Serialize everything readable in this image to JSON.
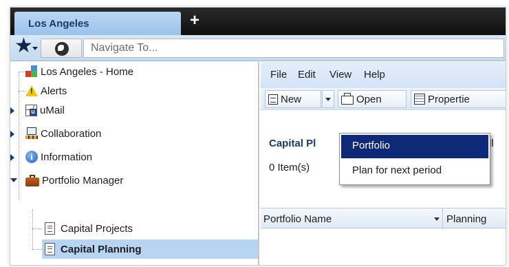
{
  "tab": {
    "title": "Los Angeles",
    "new_tab": "+"
  },
  "nav": {
    "placeholder": "Navigate To..."
  },
  "sidebar": {
    "items": [
      {
        "label": "Los Angeles - Home"
      },
      {
        "label": "Alerts"
      },
      {
        "label": "uMail"
      },
      {
        "label": "Collaboration"
      },
      {
        "label": "Information"
      },
      {
        "label": "Portfolio Manager"
      },
      {
        "label": "Capital Projects"
      },
      {
        "label": "Capital Planning"
      }
    ]
  },
  "menu": {
    "file": "File",
    "edit": "Edit",
    "view": "View",
    "help": "Help"
  },
  "toolbar": {
    "new": "New",
    "open": "Open",
    "properties": "Propertie"
  },
  "content": {
    "title": "Capital Pl",
    "all": "All",
    "count": "0  Item(s)"
  },
  "grid": {
    "col1": "Portfolio Name",
    "col2": "Planning"
  },
  "dropdown": {
    "items": [
      {
        "label": "Portfolio"
      },
      {
        "label": "Plan for next period"
      }
    ]
  }
}
